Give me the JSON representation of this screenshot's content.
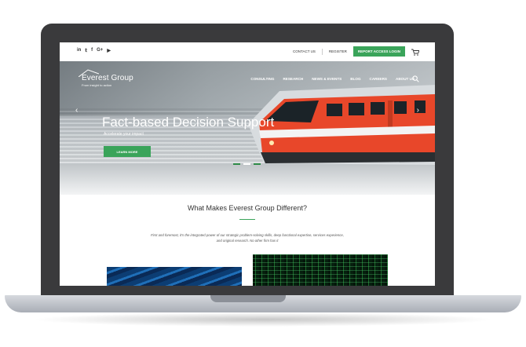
{
  "social": [
    "in",
    "𝕥",
    "f",
    "G+",
    "▶"
  ],
  "topbar": {
    "contact": "CONTACT US",
    "register": "REGISTER",
    "login_button": "REPORT ACCESS LOGIN"
  },
  "brand": {
    "name": "Everest Group",
    "tagline": "From insight to action"
  },
  "nav": [
    "CONSULTING",
    "RESEARCH",
    "NEWS & EVENTS",
    "BLOG",
    "CAREERS",
    "ABOUT US"
  ],
  "hero": {
    "title": "Fact-based Decision Support",
    "subtitle": "Accelerate your impact",
    "button": "LEARN MORE",
    "arrow_left": "‹",
    "arrow_right": "›"
  },
  "section": {
    "title": "What Makes Everest Group Different?",
    "body": "First and foremost, it's the integrated power of our strategic problem-solving skills, deep functional expertise, services experience, and original research. No other firm has it"
  },
  "colors": {
    "accent": "#3aa45a",
    "bezel": "#3a3a3c",
    "train_red": "#e8472a"
  }
}
